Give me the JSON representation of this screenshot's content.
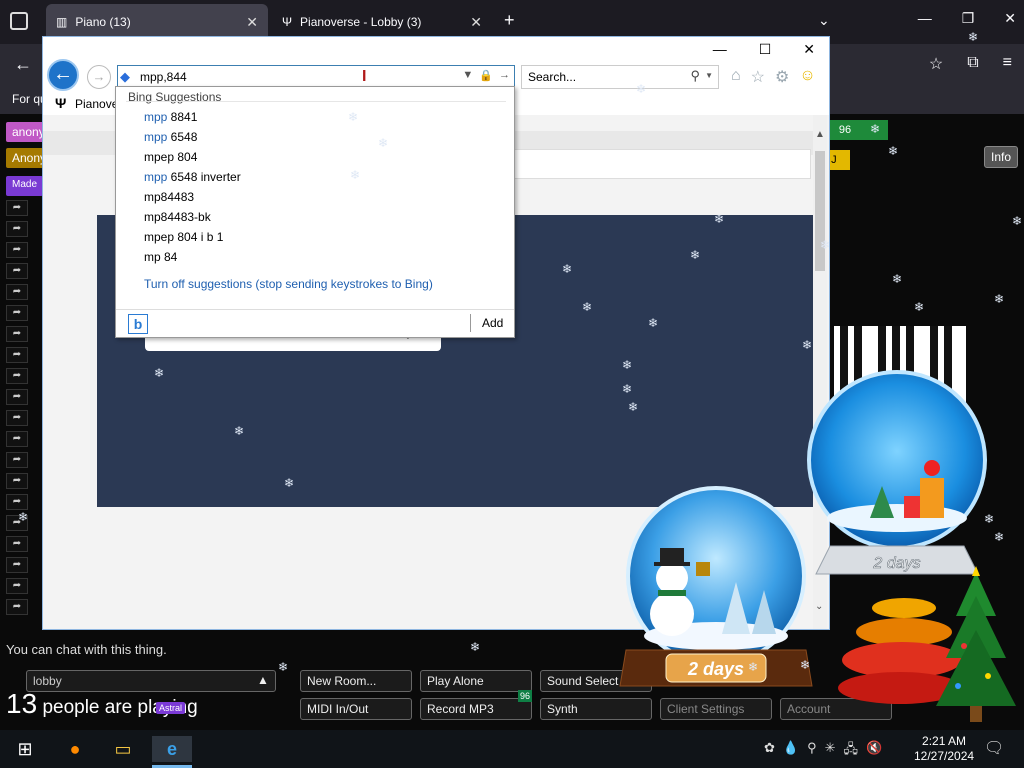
{
  "firefox": {
    "tabs": [
      {
        "title": "Piano (13)",
        "active": true
      },
      {
        "title": "Pianoverse - Lobby (3)",
        "active": false
      }
    ],
    "bookmarks_text": "For qu"
  },
  "piano": {
    "user_chips": [
      "anony",
      "Anony",
      "Made"
    ],
    "top_right_number": "96",
    "yellow_tag": "p J",
    "info_button": "Info",
    "chat_placeholder": "You can chat with this thing.",
    "room_field": "lobby",
    "people_count": "13",
    "people_text": "people are playing",
    "astral_badge": "Astral",
    "badge_number": "96",
    "buttons": {
      "new_room": "New Room...",
      "play_alone": "Play Alone",
      "sound_select": "Sound Select",
      "midi": "MIDI In/Out",
      "record": "Record MP3",
      "synth": "Synth",
      "client_settings": "Client Settings",
      "account": "Account"
    }
  },
  "ie": {
    "address_value": "mpp,844",
    "search_placeholder": "Search...",
    "tab_title": "Pianover",
    "suggestions": {
      "header": "Bing Suggestions",
      "items": [
        {
          "hl": "mpp",
          "rest": " 8841"
        },
        {
          "hl": "mpp",
          "rest": " 6548"
        },
        {
          "hl": "",
          "rest": "mpep 804"
        },
        {
          "hl": "mpp",
          "rest": " 6548 inverter"
        },
        {
          "hl": "",
          "rest": "mp84483"
        },
        {
          "hl": "",
          "rest": "mp84483-bk"
        },
        {
          "hl": "",
          "rest": "mpep 804 i b 1"
        },
        {
          "hl": "",
          "rest": "mp 84"
        }
      ],
      "turn_off": "Turn off suggestions (stop sending keystrokes to Bing)",
      "add_label": "Add"
    }
  },
  "globes": {
    "big_label": "2 days",
    "right_label": "2 days"
  },
  "taskbar": {
    "time": "2:21 AM",
    "date": "12/27/2024"
  }
}
